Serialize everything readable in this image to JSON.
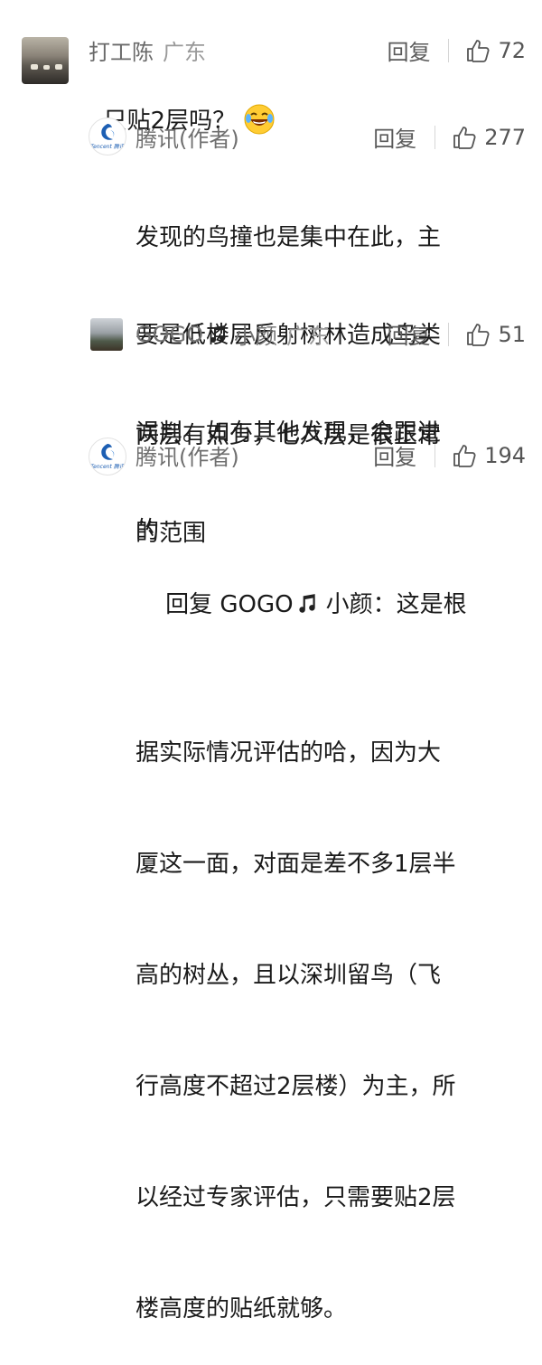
{
  "comments": [
    {
      "name": "打工陈",
      "location": "广东",
      "reply_label": "回复",
      "likes": "72",
      "text": "只贴2层吗？",
      "emoji": "laughing-tears-emoji"
    },
    {
      "name": "腾讯(作者)",
      "reply_label": "回复",
      "likes": "277",
      "avatar_word": "Tencent 腾讯",
      "text_lines": [
        "发现的鸟撞也是集中在此，主",
        "要是低楼层反射树林造成鸟类",
        "误判。如有其他发现，会跟进",
        "的"
      ]
    },
    {
      "name": "GOGO",
      "name_suffix": "小颜",
      "location": "广东",
      "reply_label": "回复",
      "likes": "51",
      "text_lines": [
        "两层有点少，七八层是很正常",
        "的范围"
      ]
    },
    {
      "name": "腾讯(作者)",
      "reply_label": "回复",
      "likes": "194",
      "avatar_word": "Tencent 腾讯",
      "reply_prefix": "回复 GOGO",
      "reply_prefix_suffix": "小颜：这是根",
      "text_lines": [
        "据实际情况评估的哈，因为大",
        "厦这一面，对面是差不多1层半",
        "高的树丛，且以深圳留鸟（飞",
        "行高度不超过2层楼）为主，所",
        "以经过专家评估，只需要贴2层",
        "楼高度的贴纸就够。"
      ]
    }
  ]
}
